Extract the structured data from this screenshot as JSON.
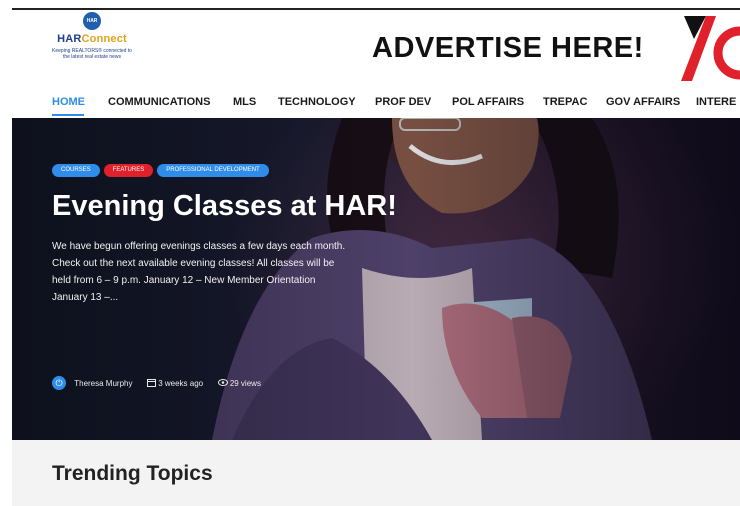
{
  "brand": {
    "logo_badge": "HAR",
    "name_part1": "HAR",
    "name_part2": "Connect",
    "tagline": "Keeping REALTORS® connected to the latest real estate news"
  },
  "ad": {
    "text": "ADVERTISE HERE!"
  },
  "nav": {
    "items": [
      {
        "label": "HOME",
        "active": true
      },
      {
        "label": "COMMUNICATIONS",
        "active": false
      },
      {
        "label": "MLS",
        "active": false
      },
      {
        "label": "TECHNOLOGY",
        "active": false
      },
      {
        "label": "PROF DEV",
        "active": false
      },
      {
        "label": "POL AFFAIRS",
        "active": false
      },
      {
        "label": "TREPAC",
        "active": false
      },
      {
        "label": "GOV AFFAIRS",
        "active": false
      },
      {
        "label": "INTERE",
        "active": false
      }
    ]
  },
  "hero": {
    "tags": [
      {
        "label": "COURSES",
        "color": "#2f8ce8"
      },
      {
        "label": "FEATURES",
        "color": "#e0202a"
      },
      {
        "label": "PROFESSIONAL DEVELOPMENT",
        "color": "#2f8ce8"
      }
    ],
    "title": "Evening Classes at HAR!",
    "excerpt": "We have begun offering evenings classes a few days each month. Check out the next available evening classes! All classes will be held from 6 – 9 p.m. January 12 – New Member Orientation January 13 –...",
    "author": "Theresa Murphy",
    "date": "3 weeks ago",
    "views": "29 views"
  },
  "trending": {
    "title": "Trending Topics"
  },
  "colors": {
    "accent": "#2f8ce8",
    "feature_red": "#e0202a",
    "brand_navy": "#1f3f8a",
    "brand_gold": "#e2a21b"
  }
}
